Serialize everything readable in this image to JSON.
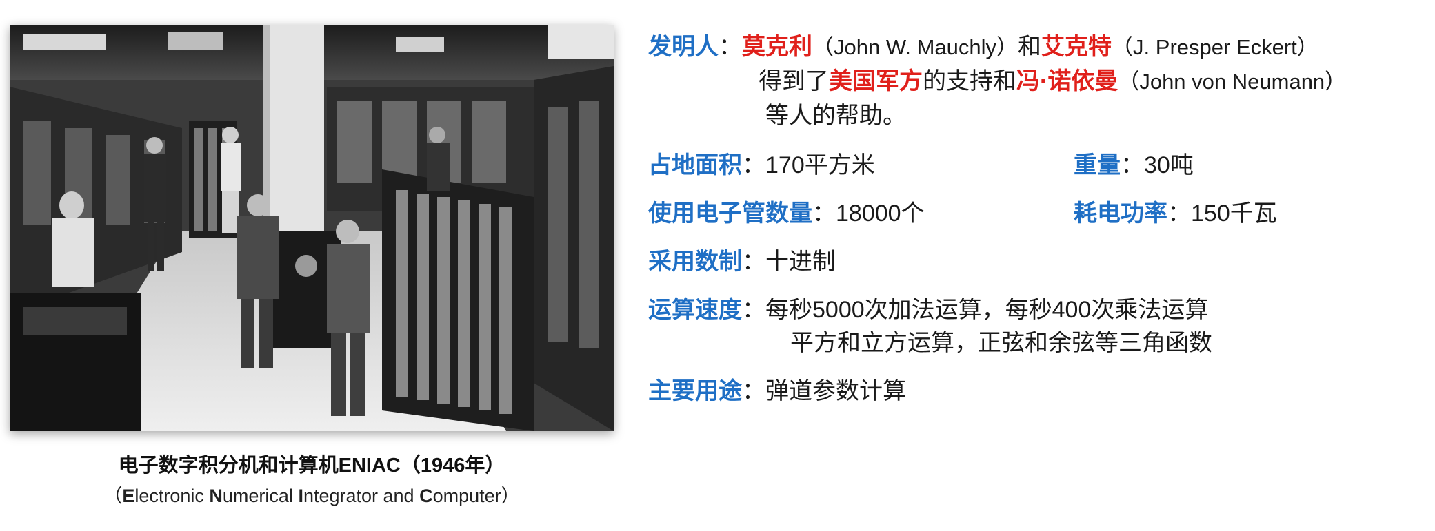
{
  "photo": {
    "description_icon": "eniac-photo"
  },
  "caption": {
    "title": "电子数字积分机和计算机ENIAC（1946年）",
    "sub_open": "（",
    "sub_E": "E",
    "sub_1": "lectronic ",
    "sub_N": "N",
    "sub_2": "umerical ",
    "sub_I": "I",
    "sub_3": "ntegrator and ",
    "sub_C": "C",
    "sub_4": "omputer）"
  },
  "inventor": {
    "label": "发明人",
    "colon": "：",
    "name1": "莫克利",
    "name1_en": "（John W. Mauchly）",
    "and": "和",
    "name2": "艾克特",
    "name2_en": "（J. Presper Eckert）",
    "line2_a": "得到了",
    "support": "美国军方",
    "line2_b": "的支持和",
    "name3": "冯·诺依曼",
    "name3_en": "（John von Neumann）",
    "line3": "等人的帮助。"
  },
  "area": {
    "label": "占地面积",
    "colon": "：",
    "value": "170平方米"
  },
  "weight": {
    "label": "重量",
    "colon": "：",
    "value": "30吨"
  },
  "tubes": {
    "label": "使用电子管数量",
    "colon": "：",
    "value": "18000个"
  },
  "power": {
    "label": "耗电功率",
    "colon": "：",
    "value": "150千瓦"
  },
  "numeral": {
    "label": "采用数制",
    "colon": "：",
    "value": "十进制"
  },
  "speed": {
    "label": "运算速度",
    "colon": "：",
    "line1": "每秒5000次加法运算，每秒400次乘法运算",
    "line2": "平方和立方运算，正弦和余弦等三角函数"
  },
  "usage": {
    "label": "主要用途",
    "colon": "：",
    "value": "弹道参数计算"
  },
  "colors": {
    "label_blue": "#1f6fc5",
    "highlight_red": "#e0201b"
  }
}
